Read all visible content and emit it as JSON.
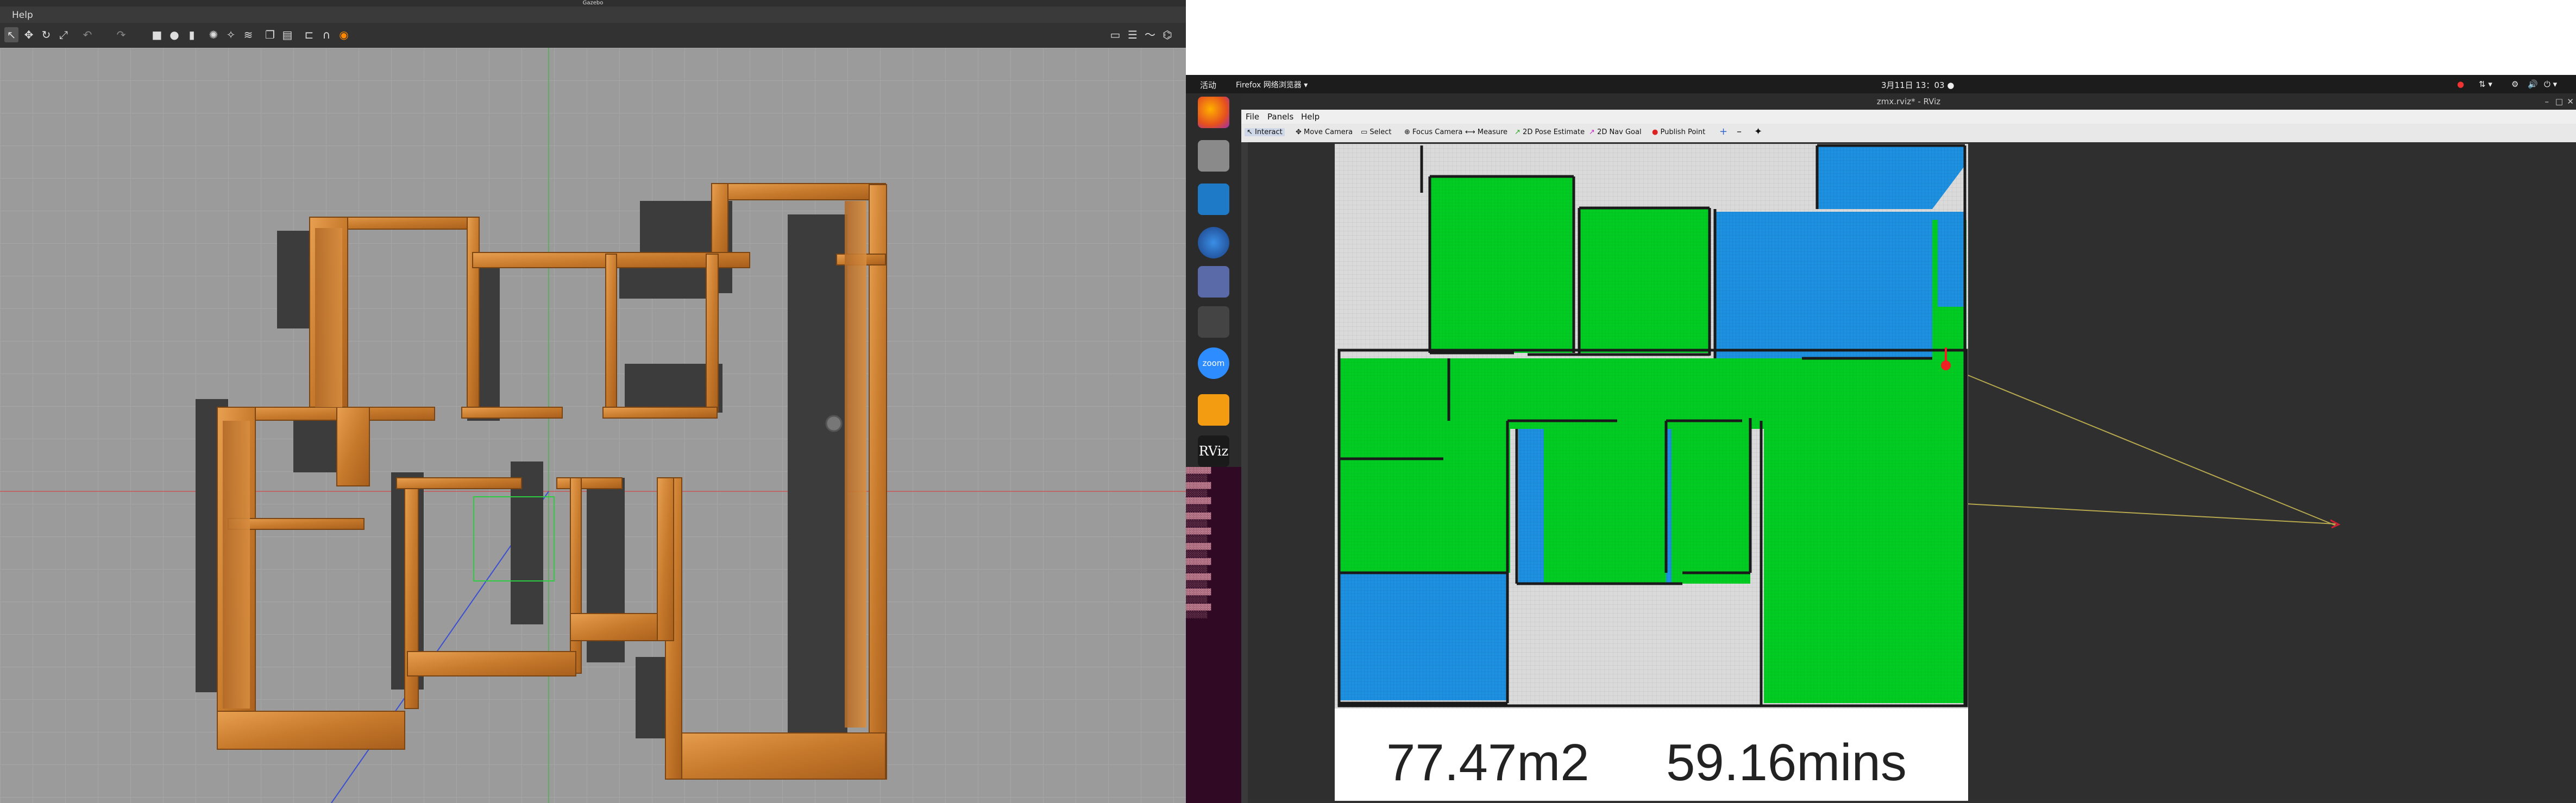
{
  "gazebo": {
    "menu": {
      "help": "Help"
    },
    "toolbar_icons": [
      "arrow-select-icon",
      "translate-icon",
      "rotate-icon",
      "scale-icon",
      "undo-icon",
      "redo-icon",
      "box-icon",
      "sphere-icon",
      "cylinder-icon",
      "point-light-icon",
      "spot-light-icon",
      "directional-light-icon",
      "copy-icon",
      "paste-icon",
      "align-icon",
      "snap-icon",
      "record-icon",
      "screenshot-icon",
      "log-icon",
      "plot-icon",
      "camera-icon"
    ]
  },
  "desktop": {
    "activities": "活动",
    "firefox_label": "Firefox 网络浏览器 ▾",
    "clock": "3月11日 13：03 ●",
    "dock_items": [
      "firefox-icon",
      "files-icon",
      "vscode-icon",
      "chromium-icon",
      "discord-icon",
      "terminal-icon",
      "zoom-icon",
      "layers-icon",
      "rviz-icon"
    ],
    "zoom_label": "zoom",
    "rviz_label": "RViz"
  },
  "rviz": {
    "window_title": "zmx.rviz* - RViz",
    "menu": {
      "file": "File",
      "panels": "Panels",
      "help": "Help"
    },
    "toolbar": {
      "interact": "Interact",
      "move_camera": "Move Camera",
      "select": "Select",
      "focus_camera": "Focus Camera",
      "measure": "Measure",
      "pose_estimate": "2D Pose Estimate",
      "nav_goal": "2D Nav Goal",
      "publish_point": "Publish Point"
    },
    "stats": {
      "area": "77.47m2",
      "time": "59.16mins"
    },
    "colors": {
      "covered": "#00cc22",
      "explored_blue": "#1e90e0",
      "free_grid": "#d8d8d8",
      "wall": "#1a1a1a"
    }
  }
}
